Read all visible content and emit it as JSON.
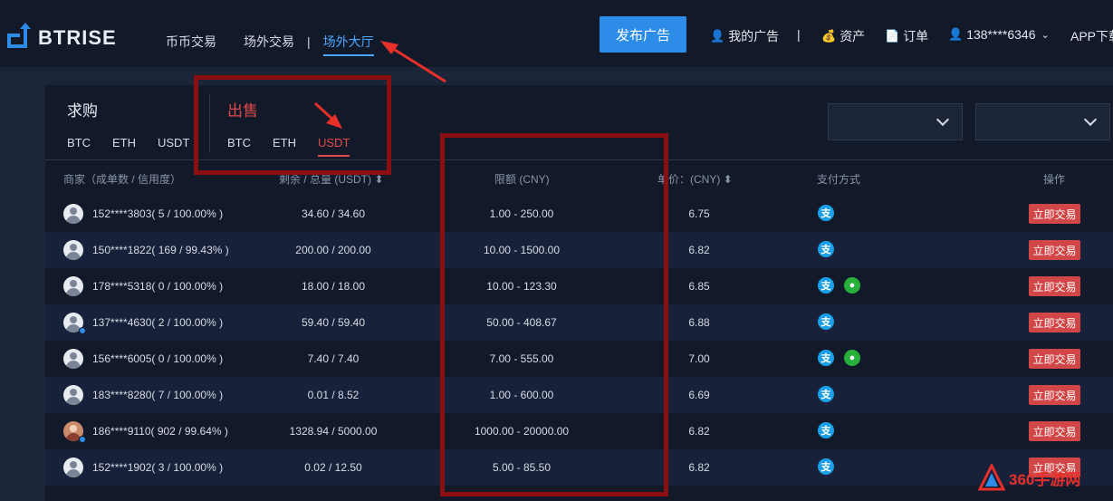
{
  "header": {
    "logo_text": "BTRISE",
    "nav": [
      "币币交易",
      "场外交易",
      "场外大厅"
    ],
    "nav_sep": "|",
    "publish_label": "发布广告",
    "my_ads": "我的广告",
    "sep": "|",
    "assets": "资产",
    "orders": "订单",
    "user": "138****6346",
    "app": "APP下载"
  },
  "tabs": {
    "buy_title": "求购",
    "sell_title": "出售",
    "buy_coins": [
      "BTC",
      "ETH",
      "USDT"
    ],
    "sell_coins": [
      "BTC",
      "ETH",
      "USDT"
    ],
    "active_coin": "USDT"
  },
  "table": {
    "headers": {
      "merchant": "商家（成单数 / 信用度）",
      "remaining": "剩余 / 总量 (USDT) ⬍",
      "limit": "限额 (CNY)",
      "price": "单价：(CNY) ⬍",
      "payment": "支付方式",
      "action": "操作"
    },
    "action_label": "立即交易",
    "rows": [
      {
        "merchant": "152****3803( 5 / 100.00% )",
        "amount": "34.60 / 34.60",
        "limit": "1.00 - 250.00",
        "price": "6.75",
        "wechat": false,
        "badge": false,
        "photo": false
      },
      {
        "merchant": "150****1822( 169 / 99.43% )",
        "amount": "200.00 / 200.00",
        "limit": "10.00 - 1500.00",
        "price": "6.82",
        "wechat": false,
        "badge": false,
        "photo": false
      },
      {
        "merchant": "178****5318( 0 / 100.00% )",
        "amount": "18.00 / 18.00",
        "limit": "10.00 - 123.30",
        "price": "6.85",
        "wechat": true,
        "badge": false,
        "photo": false
      },
      {
        "merchant": "137****4630( 2 / 100.00% )",
        "amount": "59.40 / 59.40",
        "limit": "50.00 - 408.67",
        "price": "6.88",
        "wechat": false,
        "badge": true,
        "photo": false
      },
      {
        "merchant": "156****6005( 0 / 100.00% )",
        "amount": "7.40 / 7.40",
        "limit": "7.00 - 555.00",
        "price": "7.00",
        "wechat": true,
        "badge": false,
        "photo": false
      },
      {
        "merchant": "183****8280( 7 / 100.00% )",
        "amount": "0.01 / 8.52",
        "limit": "1.00 - 600.00",
        "price": "6.69",
        "wechat": false,
        "badge": false,
        "photo": false
      },
      {
        "merchant": "186****9110( 902 / 99.64% )",
        "amount": "1328.94 / 5000.00",
        "limit": "1000.00 - 20000.00",
        "price": "6.82",
        "wechat": false,
        "badge": true,
        "photo": true
      },
      {
        "merchant": "152****1902( 3 / 100.00% )",
        "amount": "0.02 / 12.50",
        "limit": "5.00 - 85.50",
        "price": "6.82",
        "wechat": false,
        "badge": false,
        "photo": false
      }
    ]
  },
  "pay_ali_glyph": "支",
  "watermark": "360手游网",
  "colors": {
    "accent": "#2d8ce8",
    "sell": "#e14a4a",
    "annotation": "#8b0e10"
  }
}
